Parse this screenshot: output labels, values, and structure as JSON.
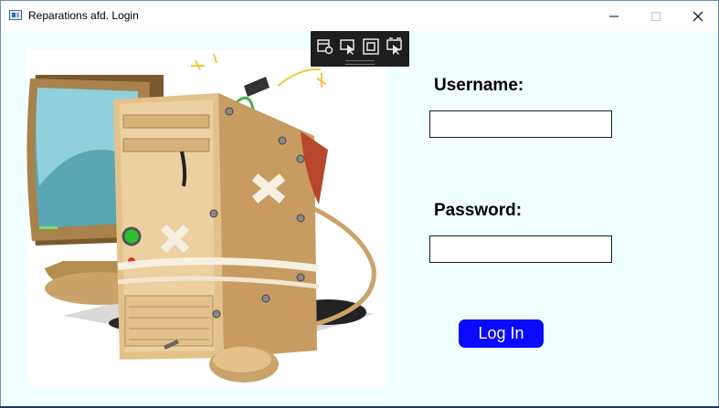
{
  "window": {
    "title": "Reparations afd. Login",
    "background_color": "#f0ffff"
  },
  "titlebar_buttons": {
    "minimize_icon": "minimize-icon",
    "maximize_icon": "maximize-icon",
    "close_icon": "close-icon"
  },
  "debug_toolbar": {
    "tools": [
      "live-visual-tree-icon",
      "select-element-icon",
      "display-layout-adorners-icon",
      "track-focused-element-icon"
    ]
  },
  "illustration": {
    "description_icon": "broken-computer-illustration"
  },
  "form": {
    "username_label": "Username:",
    "username_value": "",
    "password_label": "Password:",
    "password_value": "",
    "login_label": "Log In",
    "login_color": "#0a0aff"
  }
}
